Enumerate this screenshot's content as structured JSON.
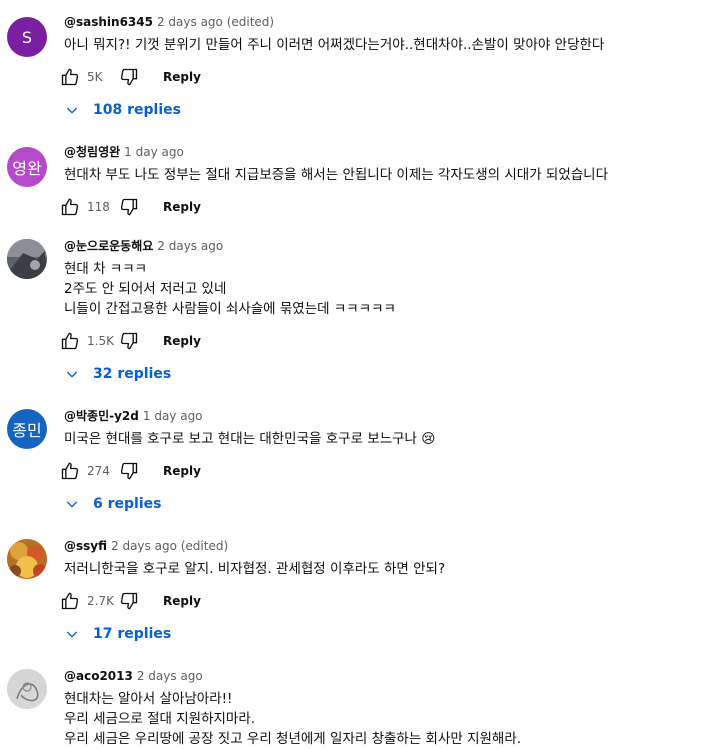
{
  "comments": [
    {
      "author": "@sashin6345",
      "time": "2 days ago (edited)",
      "avatar_text": "S",
      "avatar_color": "#7b1fa2",
      "lines": [
        "아니 뭐지?! 기껏 분위기 만들어 주니 이러면 어쩌겠다는거야..현대차야..손발이 맞아야 안당한다"
      ],
      "likes": "5K",
      "reply_label": "Reply",
      "replies": "108 replies"
    },
    {
      "author": "@청림영완",
      "time": "1 day ago",
      "avatar_text": "영완",
      "avatar_color": "#b44ac9",
      "lines": [
        "현대차 부도 나도 정부는 절대 지급보증을 해서는 안됩니다 이제는 각자도생의 시대가 되었습니다"
      ],
      "likes": "118",
      "reply_label": "Reply"
    },
    {
      "author": "@눈으로운동해요",
      "time": "2 days ago",
      "avatar_text": "",
      "avatar_color": "#6b6f75",
      "lines": [
        "현대 차 ㅋㅋㅋ",
        "2주도 안 되어서 저러고 있네",
        "니들이 간접고용한 사람들이 쇠사슬에 묶였는데 ㅋㅋㅋㅋㅋ"
      ],
      "likes": "1.5K",
      "reply_label": "Reply",
      "replies": "32 replies"
    },
    {
      "author": "@박종민-y2d",
      "time": "1 day ago",
      "avatar_text": "종민",
      "avatar_color": "#1565c0",
      "lines": [
        "미국은 현대를 호구로 보고 현대는 대한민국을 호구로 보느구나 😢"
      ],
      "likes": "274",
      "reply_label": "Reply",
      "replies": "6 replies"
    },
    {
      "author": "@ssyfi",
      "time": "2 days ago (edited)",
      "avatar_text": "",
      "avatar_color": "#c9862e",
      "lines": [
        "저러니한국을 호구로 알지. 비자협정. 관세협정 이후라도 하면 안되?"
      ],
      "likes": "2.7K",
      "reply_label": "Reply",
      "replies": "17 replies"
    },
    {
      "author": "@aco2013",
      "time": "2 days ago",
      "avatar_text": "",
      "avatar_color": "#cfcfcf",
      "lines": [
        "현대차는 알아서 살아남아라!!",
        "우리 세금으로 절대 지원하지마라.",
        "우리 세금은 우리땅에 공장 짓고 우리 청년에게 일자리  창출하는 회사만 지원해라."
      ]
    }
  ]
}
